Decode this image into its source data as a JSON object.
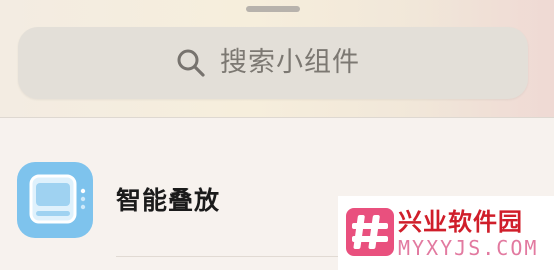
{
  "search": {
    "placeholder": "搜索小组件",
    "icon": "search-icon"
  },
  "widgets": [
    {
      "title": "智能叠放",
      "icon": "smart-stack-icon",
      "icon_color": "#7ec3ed"
    }
  ],
  "watermark": {
    "name": "兴业软件园",
    "url": "MYXYJS.COM",
    "brand_color": "#d01e2a",
    "accent_color": "#e27aa0"
  }
}
